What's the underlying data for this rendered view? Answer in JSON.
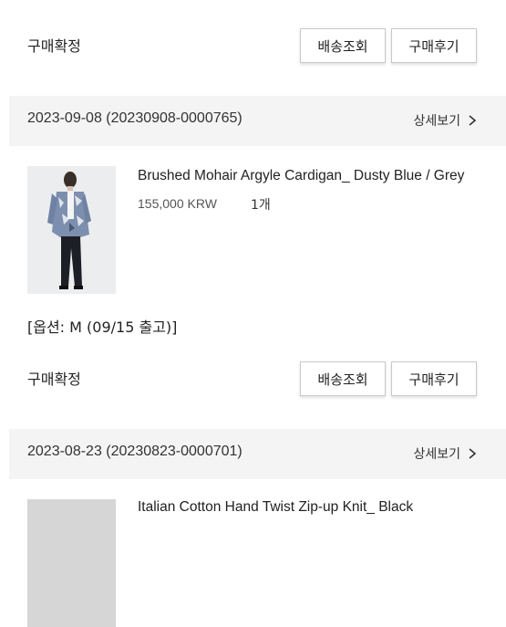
{
  "orders_top": {
    "status_label": "구매확정",
    "track_button": "배송조회",
    "review_button": "구매후기"
  },
  "orders": [
    {
      "order_id": "2023-09-08 (20230908-0000765)",
      "detail_link": "상세보기",
      "product_name": "Brushed Mohair Argyle Cardigan_ Dusty Blue / Grey",
      "price": "155,000 KRW",
      "quantity": "1개",
      "option": "[옵션: M (09/15 출고)]",
      "status_label": "구매확정",
      "track_button": "배송조회",
      "review_button": "구매후기"
    },
    {
      "order_id": "2023-08-23 (20230823-0000701)",
      "detail_link": "상세보기",
      "product_name": "Italian Cotton Hand Twist Zip-up Knit_ Black"
    }
  ]
}
